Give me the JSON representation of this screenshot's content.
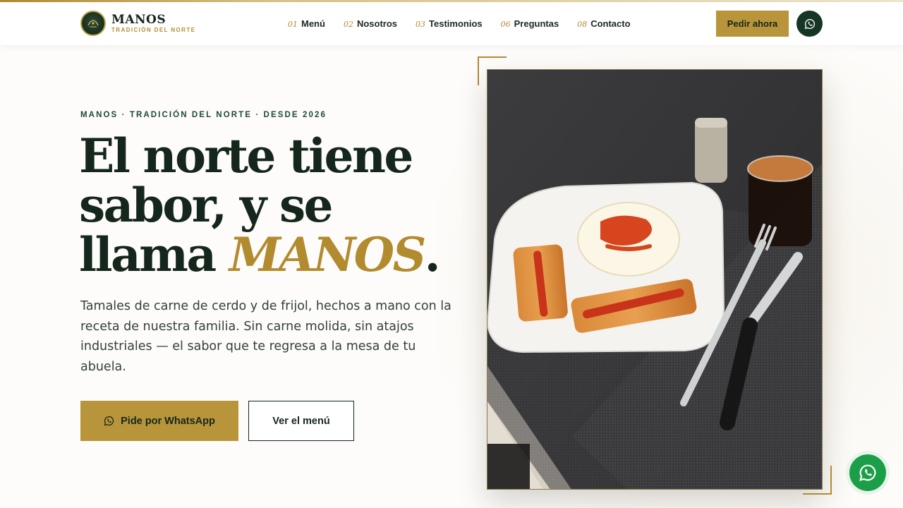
{
  "brand": {
    "name": "MANOS",
    "tagline": "TRADICIÓN DEL NORTE"
  },
  "nav": {
    "items": [
      {
        "num": "01",
        "label": "Menú"
      },
      {
        "num": "02",
        "label": "Nosotros"
      },
      {
        "num": "03",
        "label": "Testimonios"
      },
      {
        "num": "06",
        "label": "Preguntas"
      },
      {
        "num": "08",
        "label": "Contacto"
      }
    ],
    "order_label": "Pedir ahora"
  },
  "hero": {
    "eyebrow": "MANOS · TRADICIÓN DEL NORTE · DESDE 2026",
    "title_line1": "El norte tiene",
    "title_line2": "sabor, y se",
    "title_line3_prefix": "llama ",
    "title_accent": "MANOS",
    "title_period": ".",
    "lead": "Tamales de carne de cerdo y de frijol, hechos a mano con la receta de nuestra familia. Sin carne molida, sin atajos industriales — el sabor que te regresa a la mesa de tu abuela.",
    "cta_whatsapp": "Pide por WhatsApp",
    "cta_menu": "Ver el menú"
  },
  "colors": {
    "accent": "#b8953a",
    "dark_green": "#163524",
    "whatsapp_green": "#1c9e48"
  },
  "icons": {
    "header_whatsapp": "whatsapp-icon",
    "floating_whatsapp": "whatsapp-icon"
  }
}
